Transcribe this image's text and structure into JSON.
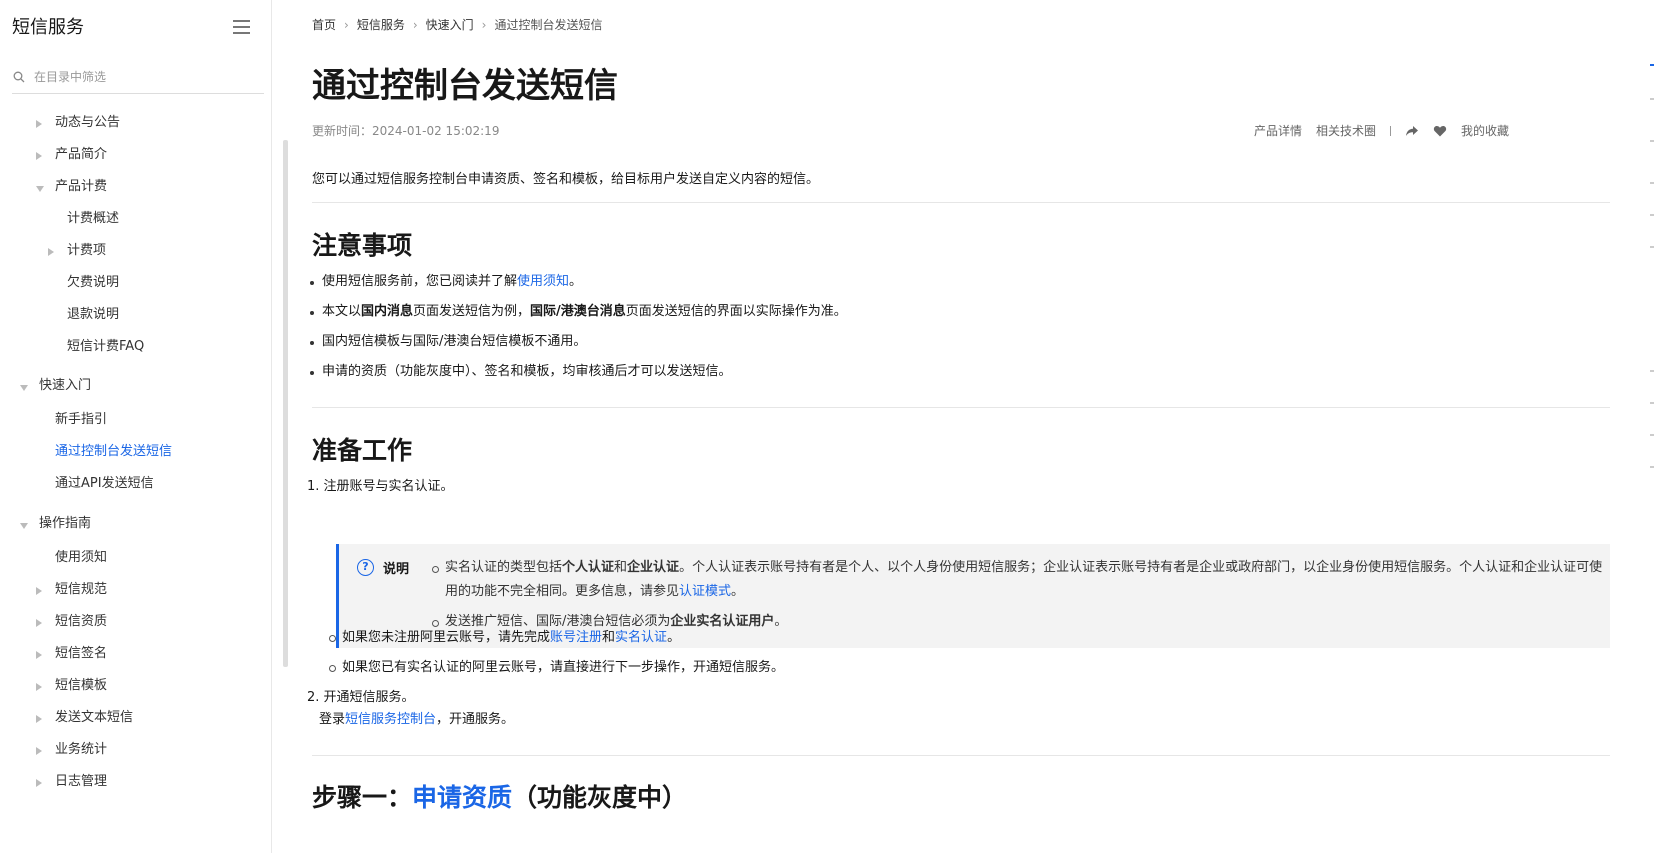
{
  "sidebar": {
    "title": "短信服务",
    "search_placeholder": "在目录中筛选",
    "items": [
      {
        "label": "动态与公告"
      },
      {
        "label": "产品简介"
      },
      {
        "label": "产品计费"
      },
      {
        "label": "计费概述"
      },
      {
        "label": "计费项"
      },
      {
        "label": "欠费说明"
      },
      {
        "label": "退款说明"
      },
      {
        "label": "短信计费FAQ"
      },
      {
        "label": "快速入门"
      },
      {
        "label": "新手指引"
      },
      {
        "label": "通过控制台发送短信"
      },
      {
        "label": "通过API发送短信"
      },
      {
        "label": "操作指南"
      },
      {
        "label": "使用须知"
      },
      {
        "label": "短信规范"
      },
      {
        "label": "短信资质"
      },
      {
        "label": "短信签名"
      },
      {
        "label": "短信模板"
      },
      {
        "label": "发送文本短信"
      },
      {
        "label": "业务统计"
      },
      {
        "label": "日志管理"
      }
    ]
  },
  "breadcrumb": [
    "首页",
    "短信服务",
    "快速入门",
    "通过控制台发送短信"
  ],
  "page": {
    "title": "通过控制台发送短信",
    "updated": "更新时间：2024-01-02 15:02:19",
    "toolbar": {
      "product_detail": "产品详情",
      "tech_circle": "相关技术圈",
      "favorite": "我的收藏"
    },
    "intro": "您可以通过短信服务控制台申请资质、签名和模板，给目标用户发送自定义内容的短信。"
  },
  "notice": {
    "heading": "注意事项",
    "b1_pre": "使用短信服务前，您已阅读并了解",
    "b1_link": "使用须知",
    "b1_post": "。",
    "b2_pre": "本文以",
    "b2_bold1": "国内消息",
    "b2_mid": "页面发送短信为例，",
    "b2_bold2": "国际/港澳台消息",
    "b2_post": "页面发送短信的界面以实际操作为准。",
    "b3": "国内短信模板与国际/港澳台短信模板不通用。",
    "b4": "申请的资质（功能灰度中）、签名和模板，均审核通后才可以发送短信。"
  },
  "prep": {
    "heading": "准备工作",
    "step1": "1. 注册账号与实名认证。",
    "note_label": "说明",
    "note1_pre": "实名认证的类型包括",
    "note1_bold1": "个人认证",
    "note1_and": "和",
    "note1_bold2": "企业认证",
    "note1_mid": "。个人认证表示账号持有者是个人、以个人身份使用短信服务；企业认证表示账号持有者是企业或政府部门，以企业身份使用短信服务。个人认证和企业认证可使用的功能不完全相同。更多信息，请参见",
    "note1_link": "认证模式",
    "note1_post": "。",
    "note2_pre": "发送推广短信、国际/港澳台短信必须为",
    "note2_bold": "企业实名认证用户",
    "note2_post": "。",
    "sub1_pre": "如果您未注册阿里云账号，请先完成",
    "sub1_link1": "账号注册",
    "sub1_and": "和",
    "sub1_link2": "实名认证",
    "sub1_post": "。",
    "sub2": "如果您已有实名认证的阿里云账号，请直接进行下一步操作，开通短信服务。",
    "step2": "2. 开通短信服务。",
    "step2_pre": "登录",
    "step2_link": "短信服务控制台",
    "step2_post": "，开通服务。"
  },
  "step_one": {
    "prefix": "步骤一：",
    "link": "申请资质",
    "suffix": "（功能灰度中）"
  },
  "colors": {
    "accent": "#1a66e6",
    "text": "#181818",
    "note_bg": "#f3f3f3"
  }
}
